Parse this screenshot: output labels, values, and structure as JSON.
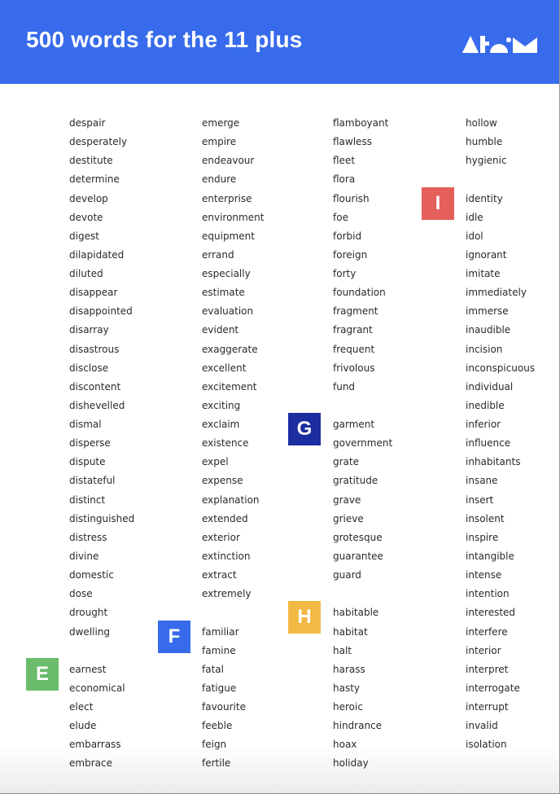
{
  "header": {
    "title": "500 words for the 11 plus",
    "logo": "atom-logo"
  },
  "colors": {
    "header_bg": "#376bec",
    "badge_E": "#6abb6a",
    "badge_F": "#376bec",
    "badge_G": "#1c2da0",
    "badge_H": "#f2b944",
    "badge_I": "#e55f5b"
  },
  "columns": [
    {
      "sections": [
        {
          "letter": "",
          "words": [
            "despair",
            "desperately",
            "destitute",
            "determine",
            "develop",
            "devote",
            "digest",
            "dilapidated",
            "diluted",
            "disappear",
            "disappointed",
            "disarray",
            "disastrous",
            "disclose",
            "discontent",
            "dishevelled",
            "dismal",
            "disperse",
            "dispute",
            "distateful",
            "distinct",
            "distinguished",
            "distress",
            "divine",
            "domestic",
            "dose",
            "drought",
            "dwelling"
          ]
        },
        {
          "letter": "E",
          "words": [
            "earnest",
            "economical",
            "elect",
            "elude",
            "embarrass",
            "embrace"
          ]
        }
      ]
    },
    {
      "sections": [
        {
          "letter": "",
          "words": [
            "emerge",
            "empire",
            "endeavour",
            "endure",
            "enterprise",
            "environment",
            "equipment",
            "errand",
            "especially",
            "estimate",
            "evaluation",
            "evident",
            "exaggerate",
            "excellent",
            "excitement",
            "exciting",
            "exclaim",
            "existence",
            "expel",
            "expense",
            "explanation",
            "extended",
            "exterior",
            "extinction",
            "extract",
            "extremely"
          ]
        },
        {
          "letter": "F",
          "words": [
            "familiar",
            "famine",
            "fatal",
            "fatigue",
            "favourite",
            "feeble",
            "feign",
            "fertile"
          ]
        }
      ]
    },
    {
      "sections": [
        {
          "letter": "",
          "words": [
            "flamboyant",
            "flawless",
            "fleet",
            "flora",
            "flourish",
            "foe",
            "forbid",
            "foreign",
            "forty",
            "foundation",
            "fragment",
            "fragrant",
            "frequent",
            "frivolous",
            "fund"
          ]
        },
        {
          "letter": "G",
          "words": [
            "garment",
            "government",
            "grate",
            "gratitude",
            "grave",
            "grieve",
            "grotesque",
            "guarantee",
            "guard"
          ]
        },
        {
          "letter": "H",
          "words": [
            "habitable",
            "habitat",
            "halt",
            "harass",
            "hasty",
            "heroic",
            "hindrance",
            "hoax",
            "holiday"
          ]
        }
      ]
    },
    {
      "sections": [
        {
          "letter": "",
          "words": [
            "hollow",
            "humble",
            "hygienic"
          ]
        },
        {
          "letter": "I",
          "words": [
            "identity",
            "idle",
            "idol",
            "ignorant",
            "imitate",
            "immediately",
            "immerse",
            "inaudible",
            "incision",
            "inconspicuous",
            "individual",
            "inedible",
            "inferior",
            "influence",
            "inhabitants",
            "insane",
            "insert",
            "insolent",
            "inspire",
            "intangible",
            "intense",
            "intention",
            "interested",
            "interfere",
            "interior",
            "interpret",
            "interrogate",
            "interrupt",
            "invalid",
            "isolation"
          ]
        }
      ]
    }
  ]
}
